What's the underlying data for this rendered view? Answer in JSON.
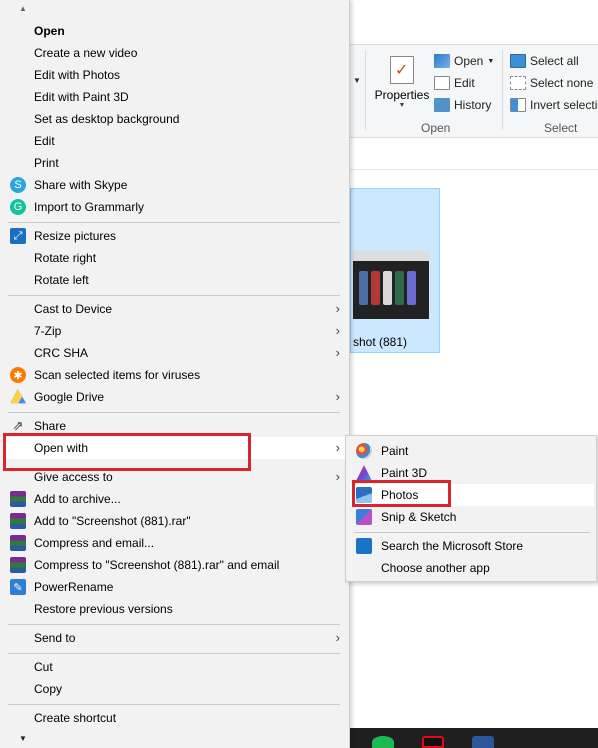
{
  "ribbon": {
    "properties_label": "Properties",
    "open_label": "Open",
    "edit_label": "Edit",
    "history_label": "History",
    "open_group_label": "Open",
    "select_all_label": "Select all",
    "select_none_label": "Select none",
    "invert_selection_label": "Invert selection",
    "select_group_label": "Select"
  },
  "file": {
    "name": "shot (881)"
  },
  "context_menu": {
    "items": [
      {
        "label": "Open",
        "bold": true
      },
      {
        "label": "Create a new video"
      },
      {
        "label": "Edit with Photos"
      },
      {
        "label": "Edit with Paint 3D"
      },
      {
        "label": "Set as desktop background"
      },
      {
        "label": "Edit"
      },
      {
        "label": "Print"
      },
      {
        "label": "Share with Skype",
        "icon": "skype-icon"
      },
      {
        "label": "Import to Grammarly",
        "icon": "grammarly-icon"
      },
      {
        "label": "Resize pictures",
        "icon": "resize-pictures-icon"
      },
      {
        "label": "Rotate right"
      },
      {
        "label": "Rotate left"
      },
      {
        "label": "Cast to Device",
        "submenu": true
      },
      {
        "label": "7-Zip",
        "submenu": true
      },
      {
        "label": "CRC SHA",
        "submenu": true
      },
      {
        "label": "Scan selected items for viruses",
        "icon": "avast-icon"
      },
      {
        "label": "Google Drive",
        "icon": "google-drive-icon",
        "submenu": true
      },
      {
        "label": "Share",
        "icon": "share-icon"
      },
      {
        "label": "Open with",
        "submenu": true,
        "highlighted": true
      },
      {
        "label": "Give access to",
        "submenu": true
      },
      {
        "label": "Add to archive...",
        "icon": "winrar-icon"
      },
      {
        "label": "Add to \"Screenshot (881).rar\"",
        "icon": "winrar-icon"
      },
      {
        "label": "Compress and email...",
        "icon": "winrar-icon"
      },
      {
        "label": "Compress to \"Screenshot (881).rar\" and email",
        "icon": "winrar-icon"
      },
      {
        "label": "PowerRename",
        "icon": "powerrename-icon"
      },
      {
        "label": "Restore previous versions"
      },
      {
        "label": "Send to",
        "submenu": true
      },
      {
        "label": "Cut"
      },
      {
        "label": "Copy"
      },
      {
        "label": "Create shortcut"
      }
    ]
  },
  "open_with_submenu": {
    "items": [
      {
        "label": "Paint",
        "icon": "paint-icon"
      },
      {
        "label": "Paint 3D",
        "icon": "paint-3d-icon"
      },
      {
        "label": "Photos",
        "icon": "photos-icon",
        "highlighted": true
      },
      {
        "label": "Snip & Sketch",
        "icon": "snip-sketch-icon"
      },
      {
        "label": "Search the Microsoft Store",
        "icon": "microsoft-store-icon"
      },
      {
        "label": "Choose another app"
      }
    ]
  },
  "colors": {
    "highlight_box": "#d9262e",
    "menu_bg": "#f2f2f2",
    "selection_bg": "#cce8ff"
  }
}
